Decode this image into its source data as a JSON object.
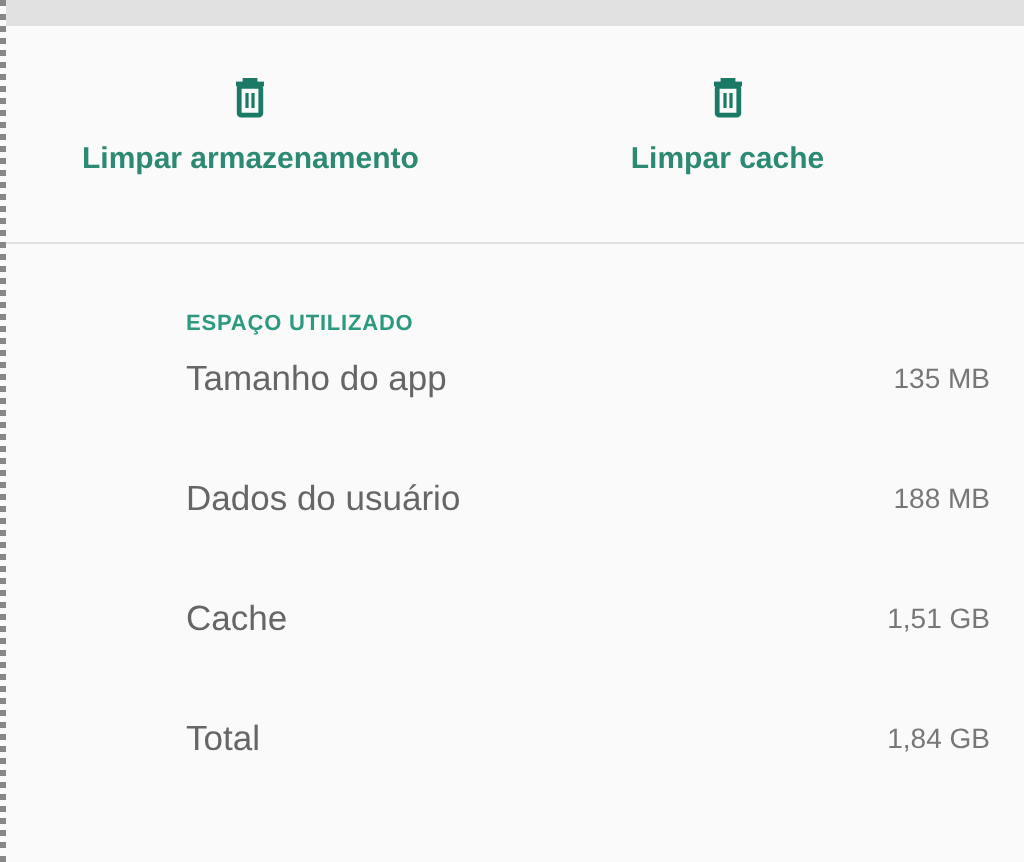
{
  "actions": [
    {
      "label": "Limpar armazenamento"
    },
    {
      "label": "Limpar cache"
    }
  ],
  "usage": {
    "heading": "ESPAÇO UTILIZADO",
    "rows": [
      {
        "name": "Tamanho do app",
        "value": "135 MB"
      },
      {
        "name": "Dados do usuário",
        "value": "188 MB"
      },
      {
        "name": "Cache",
        "value": "1,51 GB"
      },
      {
        "name": "Total",
        "value": "1,84 GB"
      }
    ]
  }
}
